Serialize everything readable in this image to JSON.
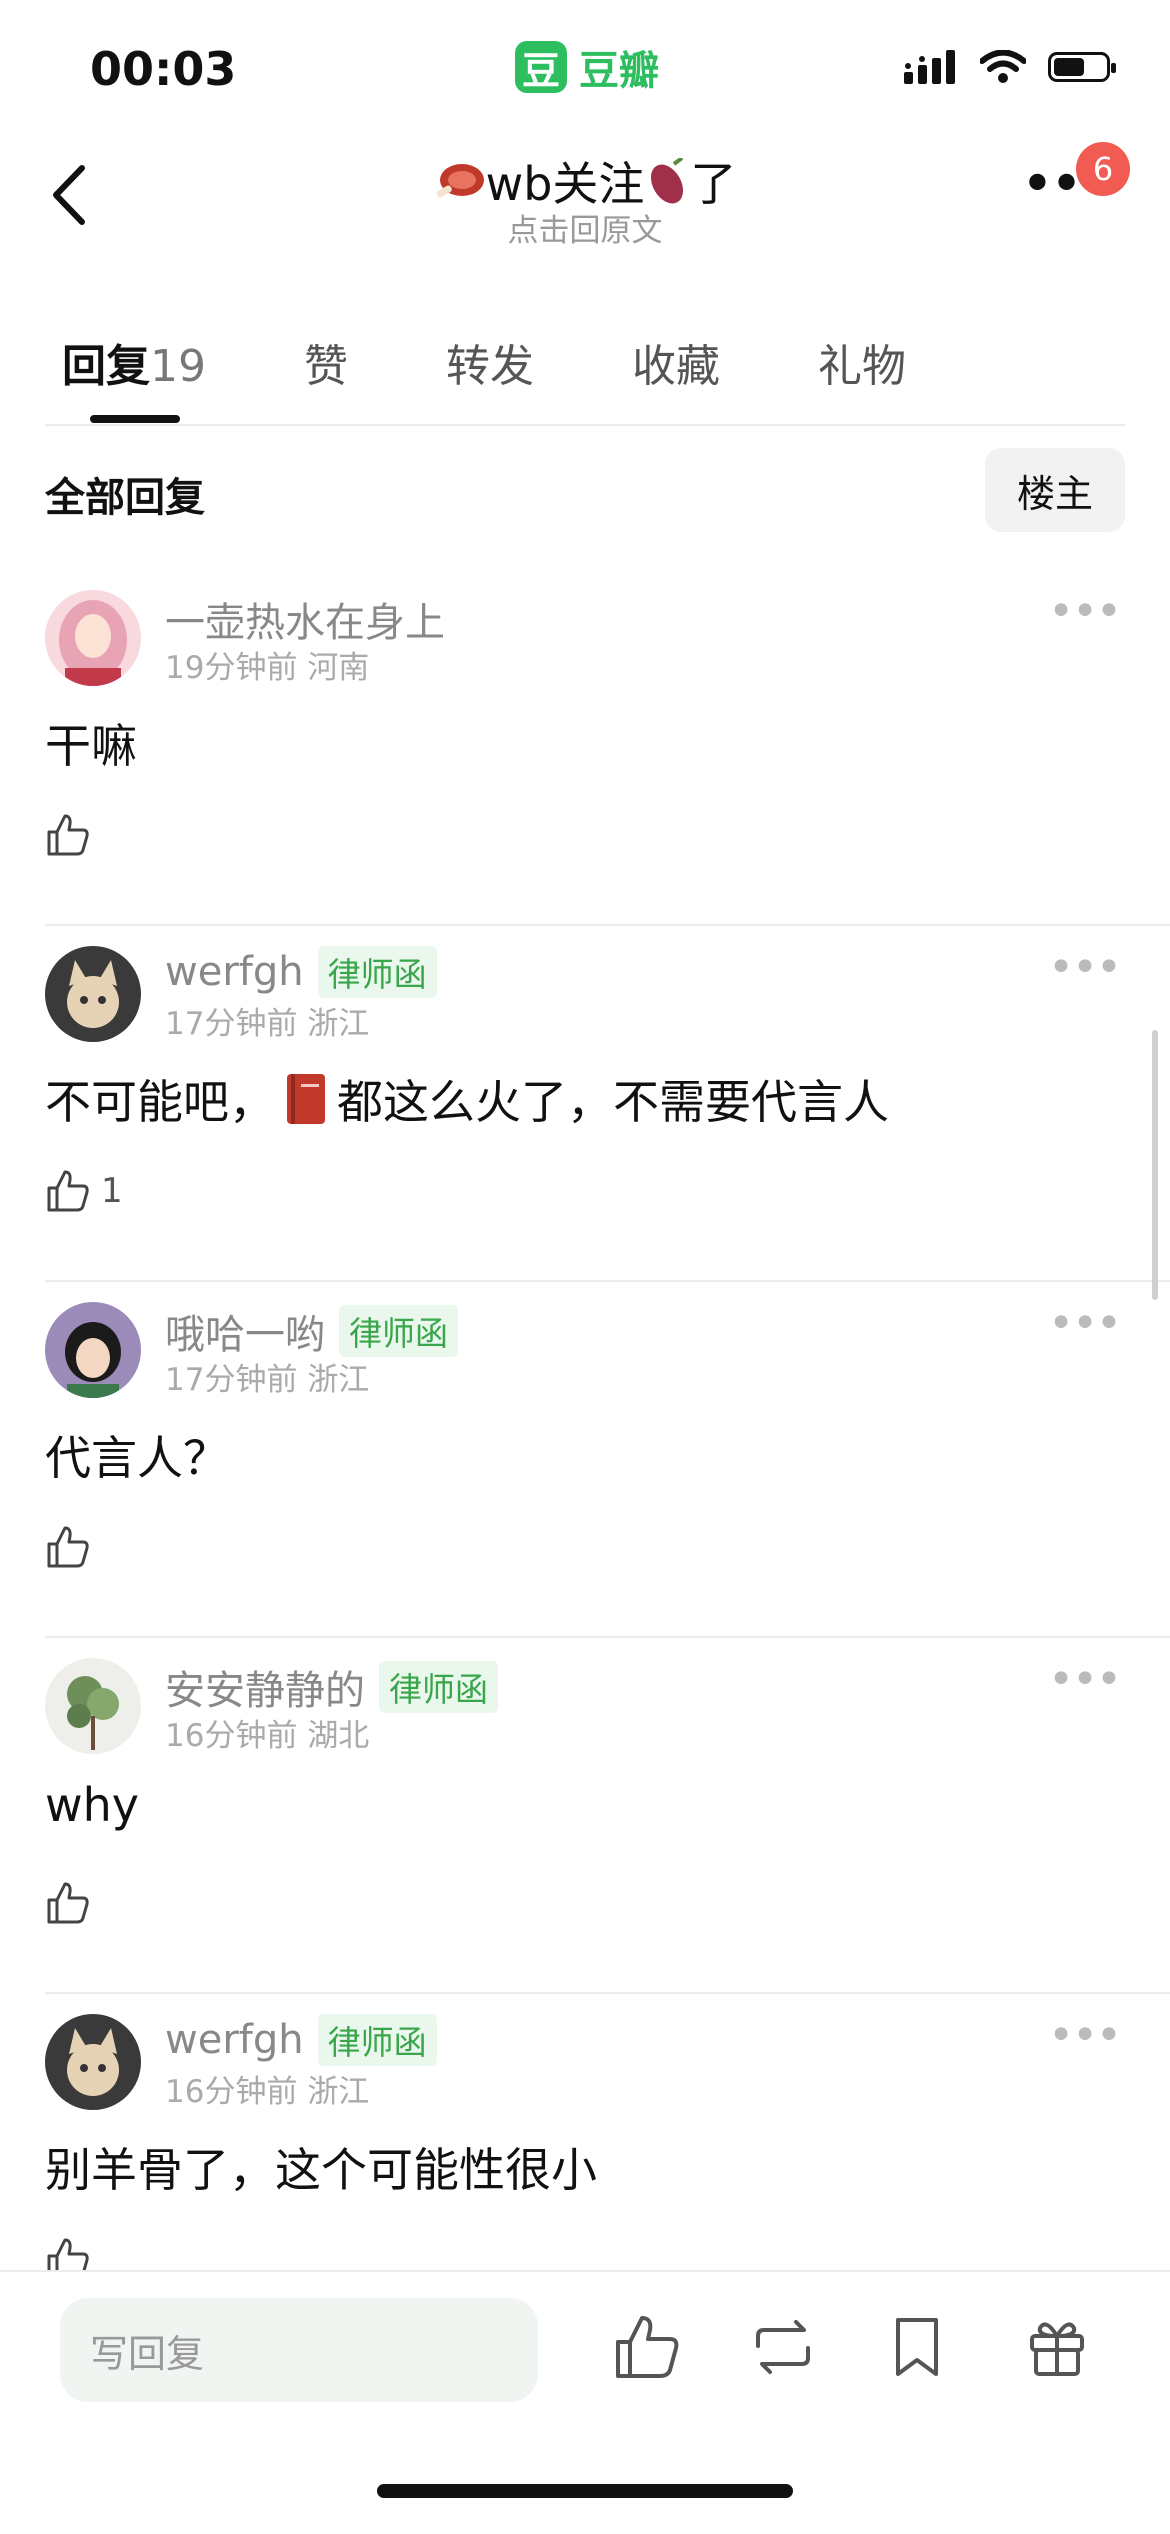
{
  "status_bar": {
    "time": "00:03",
    "app_logo_char": "豆",
    "app_name": "豆瓣"
  },
  "nav": {
    "title_prefix_icon": "meat-emoji",
    "title_text": "wb关注",
    "title_mid_icon": "sweet-potato-emoji",
    "title_suffix": "了",
    "subtitle": "点击回原文",
    "notification_count": "6"
  },
  "tabs": [
    {
      "label": "回复",
      "count": "19",
      "active": true
    },
    {
      "label": "赞"
    },
    {
      "label": "转发"
    },
    {
      "label": "收藏"
    },
    {
      "label": "礼物"
    }
  ],
  "filter": {
    "all_replies": "全部回复",
    "op_only": "楼主"
  },
  "comments": [
    {
      "user": "一壶热水在身上",
      "tag": "",
      "time": "19分钟前",
      "location": "河南",
      "text": "干嘛",
      "likes": "",
      "avatar": "pink-hair-avatar"
    },
    {
      "user": "werfgh",
      "tag": "律师函",
      "time": "17分钟前",
      "location": "浙江",
      "text_before": "不可能吧，",
      "text_icon": "red-book-emoji",
      "text_after": "都这么火了，不需要代言人",
      "likes": "1",
      "avatar": "cat-avatar"
    },
    {
      "user": "哦哈一哟",
      "tag": "律师函",
      "time": "17分钟前",
      "location": "浙江",
      "text": "代言人？",
      "likes": "",
      "avatar": "girl-avatar"
    },
    {
      "user": "安安静静的",
      "tag": "律师函",
      "time": "16分钟前",
      "location": "湖北",
      "text": "why",
      "likes": "",
      "avatar": "plant-avatar"
    },
    {
      "user": "werfgh",
      "tag": "律师函",
      "time": "16分钟前",
      "location": "浙江",
      "text": "别羊骨了，这个可能性很小",
      "likes": "",
      "avatar": "cat-avatar"
    }
  ],
  "bottom_bar": {
    "reply_placeholder": "写回复"
  },
  "colors": {
    "brand_green": "#2DBE60",
    "tag_green": "#3aa64c",
    "badge_red": "#F25B52"
  }
}
